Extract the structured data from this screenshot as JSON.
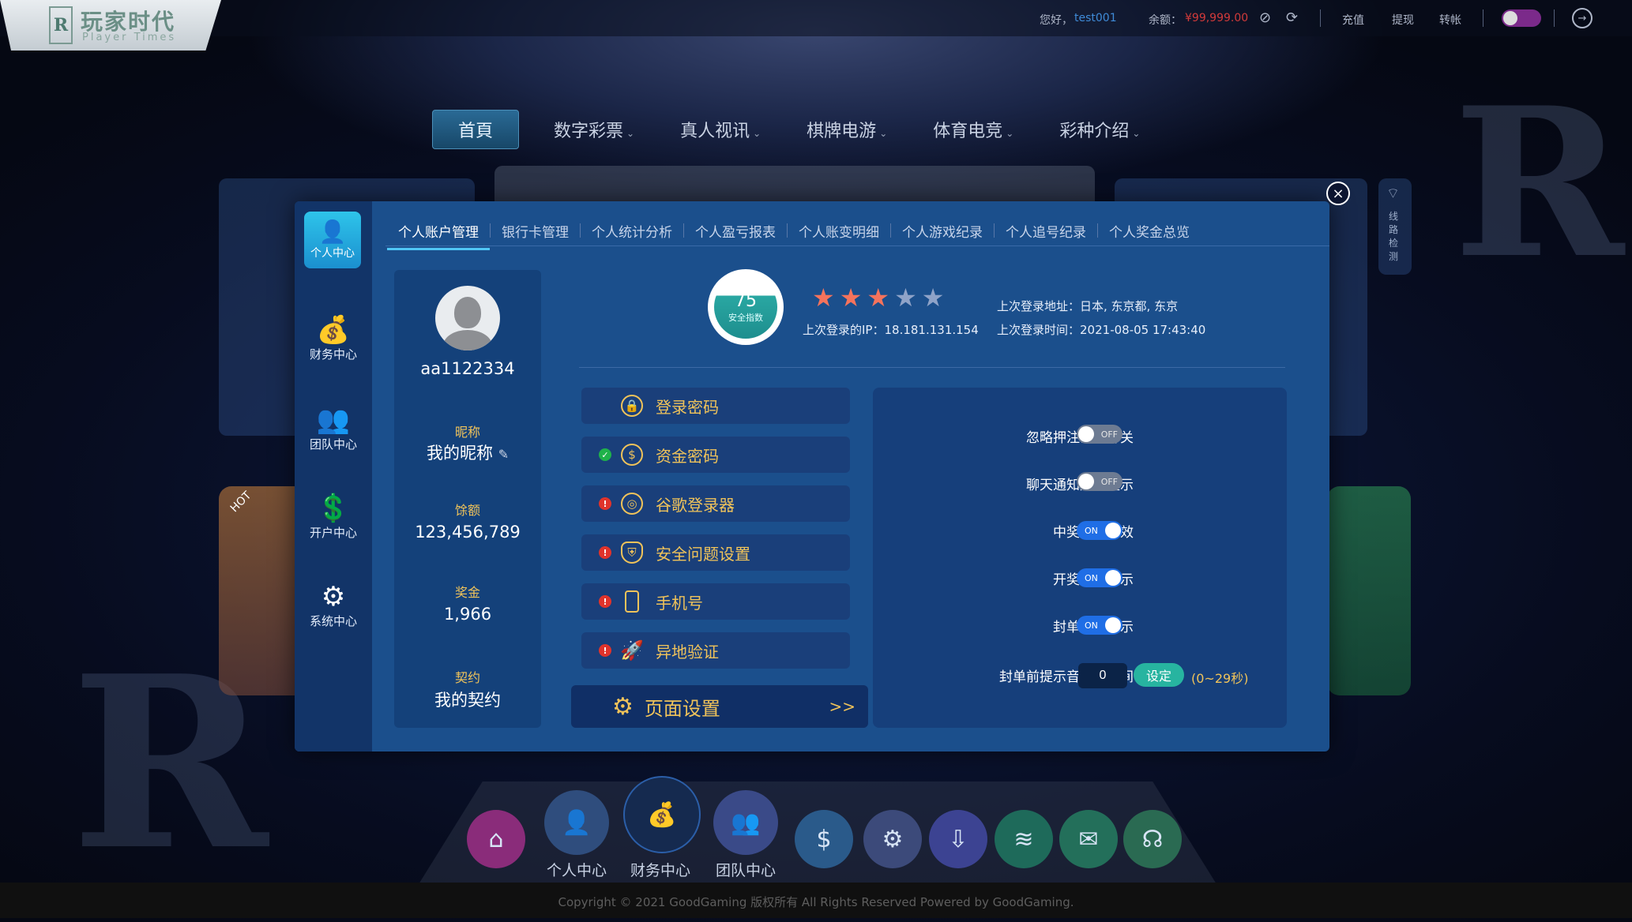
{
  "topbar": {
    "logo_mark": "R",
    "logo_cn": "玩家时代",
    "logo_en": "Player Times",
    "greeting": "您好，",
    "username": "test001",
    "balance_label": "余额：",
    "balance_value": "¥99,999.00",
    "recharge": "充值",
    "withdraw": "提现",
    "transfer": "转帐"
  },
  "nav": {
    "items": [
      {
        "label": "首頁"
      },
      {
        "label": "数字彩票"
      },
      {
        "label": "真人视讯"
      },
      {
        "label": "棋牌电游"
      },
      {
        "label": "体育电竞"
      },
      {
        "label": "彩种介绍"
      }
    ]
  },
  "background": {
    "hot_badge": "HOT",
    "line_check": "线路检测"
  },
  "modal": {
    "sidebar": [
      {
        "label": "个人中心",
        "icon": "user-shield-icon"
      },
      {
        "label": "财务中心",
        "icon": "money-bag-icon"
      },
      {
        "label": "团队中心",
        "icon": "team-icon"
      },
      {
        "label": "开户中心",
        "icon": "hand-money-icon"
      },
      {
        "label": "系统中心",
        "icon": "gears-icon"
      }
    ],
    "tabs": [
      {
        "label": "个人账户管理"
      },
      {
        "label": "银行卡管理"
      },
      {
        "label": "个人统计分析"
      },
      {
        "label": "个人盈亏报表"
      },
      {
        "label": "个人账变明细"
      },
      {
        "label": "个人游戏纪录"
      },
      {
        "label": "个人追号纪录"
      },
      {
        "label": "个人奖金总览"
      }
    ],
    "profile": {
      "username": "aa1122334",
      "nickname_label": "昵称",
      "nickname": "我的昵称",
      "balance_label": "馀额",
      "balance": "123,456,789",
      "bonus_label": "奖金",
      "bonus": "1,966",
      "contract_label": "契约",
      "contract": "我的契约"
    },
    "security": {
      "score": "75",
      "score_label": "安全指数",
      "stars_on": 3,
      "stars_total": 5,
      "last_ip_label": "上次登录的IP：",
      "last_ip": "18.181.131.154",
      "last_addr_label": "上次登录地址：",
      "last_addr": "日本, 东京都, 东京",
      "last_time_label": "上次登录时间：",
      "last_time": "2021-08-05 17:43:40",
      "items": [
        {
          "label": "登录密码",
          "status": "none",
          "icon": "lock-icon"
        },
        {
          "label": "资金密码",
          "status": "ok",
          "icon": "dollar-icon"
        },
        {
          "label": "谷歌登录器",
          "status": "warn",
          "icon": "chrome-icon"
        },
        {
          "label": "安全问题设置",
          "status": "warn",
          "icon": "shield-icon"
        },
        {
          "label": "手机号",
          "status": "warn",
          "icon": "phone-icon"
        },
        {
          "label": "异地验证",
          "status": "warn",
          "icon": "rocket-icon"
        }
      ],
      "page_setting": "页面设置",
      "page_setting_arrow": ">>"
    },
    "settings": {
      "rows": [
        {
          "label": "忽略押注确认开关",
          "state": "OFF"
        },
        {
          "label": "聊天通知声音提示",
          "state": "OFF"
        },
        {
          "label": "中奖提示音效",
          "state": "ON"
        },
        {
          "label": "开奖声音提示",
          "state": "ON"
        },
        {
          "label": "封单声音提示",
          "state": "ON"
        }
      ],
      "timer_label": "封单前提示音播放时间",
      "timer_value": "0",
      "set_button": "设定",
      "range_hint": "(0~29秒)"
    }
  },
  "dock": [
    {
      "label": "",
      "icon": "home-icon",
      "color": "#8a2c7a"
    },
    {
      "label": "个人中心",
      "icon": "user-shield-icon",
      "color": "#2f4d7d"
    },
    {
      "label": "财务中心",
      "icon": "money-bag-icon",
      "color": "#152a4f"
    },
    {
      "label": "团队中心",
      "icon": "team-icon",
      "color": "#3a4a88"
    },
    {
      "label": "",
      "icon": "hand-money-icon",
      "color": "#2a5a8a"
    },
    {
      "label": "",
      "icon": "gears-icon",
      "color": "#3c4a7a"
    },
    {
      "label": "",
      "icon": "download-icon",
      "color": "#3c4392"
    },
    {
      "label": "",
      "icon": "wifi-icon",
      "color": "#1e6a5a"
    },
    {
      "label": "",
      "icon": "mail-icon",
      "color": "#236f5a"
    },
    {
      "label": "",
      "icon": "headset-icon",
      "color": "#2a6a52"
    }
  ],
  "footer": {
    "copyright": "Copyright © 2021 GoodGaming 版权所有 All Rights Reserved Powered by GoodGaming."
  }
}
